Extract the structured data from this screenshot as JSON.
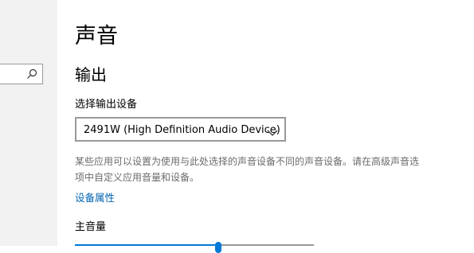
{
  "sidebar": {
    "search": {
      "icon": "search-icon",
      "value": "",
      "placeholder": ""
    }
  },
  "page": {
    "title": "声音"
  },
  "output": {
    "section_title": "输出",
    "select_label": "选择输出设备",
    "device_select": {
      "selected": "2491W (High Definition Audio Device)",
      "icon": "chevron-down-icon"
    },
    "help_text": "某些应用可以设置为使用与此处选择的声音设备不同的声音设备。请在高级声音选项中自定义应用音量和设备。",
    "device_properties_link": "设备属性",
    "master_volume": {
      "label": "主音量",
      "level_fraction": 0.6
    }
  },
  "colors": {
    "accent": "#0078d7",
    "link": "#0063b1",
    "sidebar_bg": "#f2f2f2",
    "secondary_text": "#6b6b6b"
  }
}
